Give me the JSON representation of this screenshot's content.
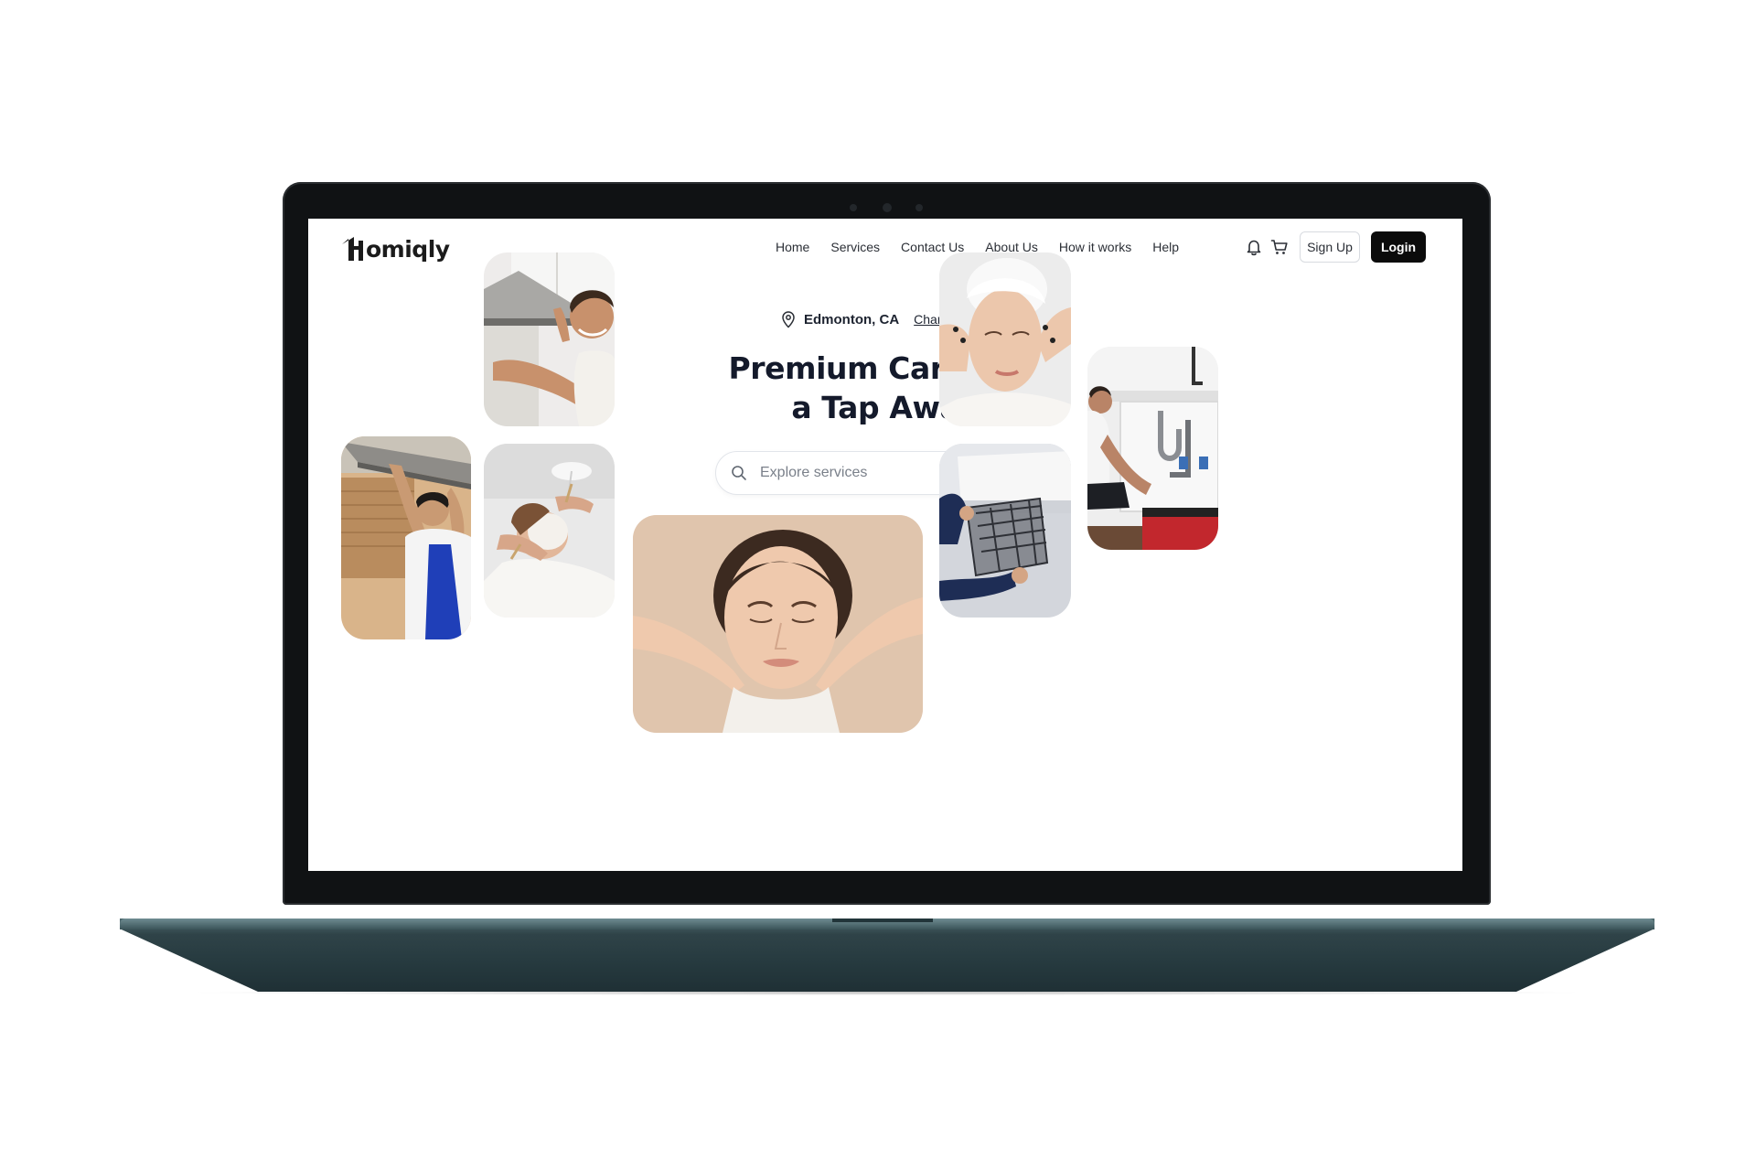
{
  "brand": {
    "logo_text": "omiqly",
    "logo_mark": "H"
  },
  "nav": {
    "links": [
      "Home",
      "Services",
      "Contact Us",
      "About Us",
      "How it works",
      "Help"
    ],
    "signup_label": "Sign Up",
    "login_label": "Login",
    "icons": [
      "bell-icon",
      "cart-icon"
    ]
  },
  "hero": {
    "location": "Edmonton, CA",
    "change_city": "Change City",
    "title": "Premium Care, Just a Tap Away.",
    "search_placeholder": "Explore services"
  },
  "tiles": [
    {
      "name": "photo-kitchen-hood-technician"
    },
    {
      "name": "photo-range-hood-repair-man"
    },
    {
      "name": "photo-facial-mask-treatment"
    },
    {
      "name": "photo-face-massage-woman"
    },
    {
      "name": "photo-skincare-towel-woman"
    },
    {
      "name": "photo-ac-filter-cleaning"
    },
    {
      "name": "photo-plumber-under-sink"
    }
  ],
  "colors": {
    "accent": "#0b0b0b",
    "title": "#141a2b",
    "laptop_body": "#263a3f",
    "bezel": "#101214"
  }
}
